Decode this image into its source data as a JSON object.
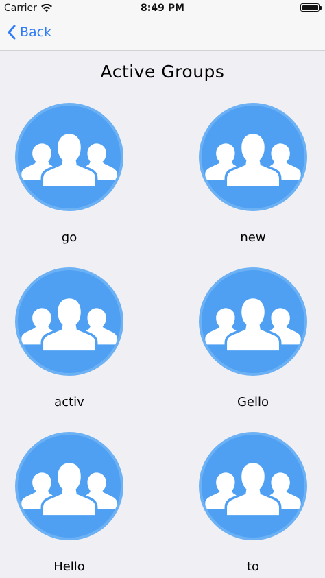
{
  "status_bar": {
    "carrier": "Carrier",
    "time": "8:49 PM",
    "battery_level": 1.0
  },
  "nav": {
    "back_label": "Back"
  },
  "page": {
    "title": "Active Groups"
  },
  "groups": [
    {
      "label": "go",
      "icon": "group-icon"
    },
    {
      "label": "new",
      "icon": "group-icon"
    },
    {
      "label": "activ",
      "icon": "group-icon"
    },
    {
      "label": "Gello",
      "icon": "group-icon"
    },
    {
      "label": "Hello",
      "icon": "group-icon"
    },
    {
      "label": "to",
      "icon": "group-icon"
    }
  ],
  "colors": {
    "accent": "#2f7cf6",
    "circle": "#4fa0f2",
    "circle_border": "#6db1f5",
    "background": "#efeff4"
  }
}
